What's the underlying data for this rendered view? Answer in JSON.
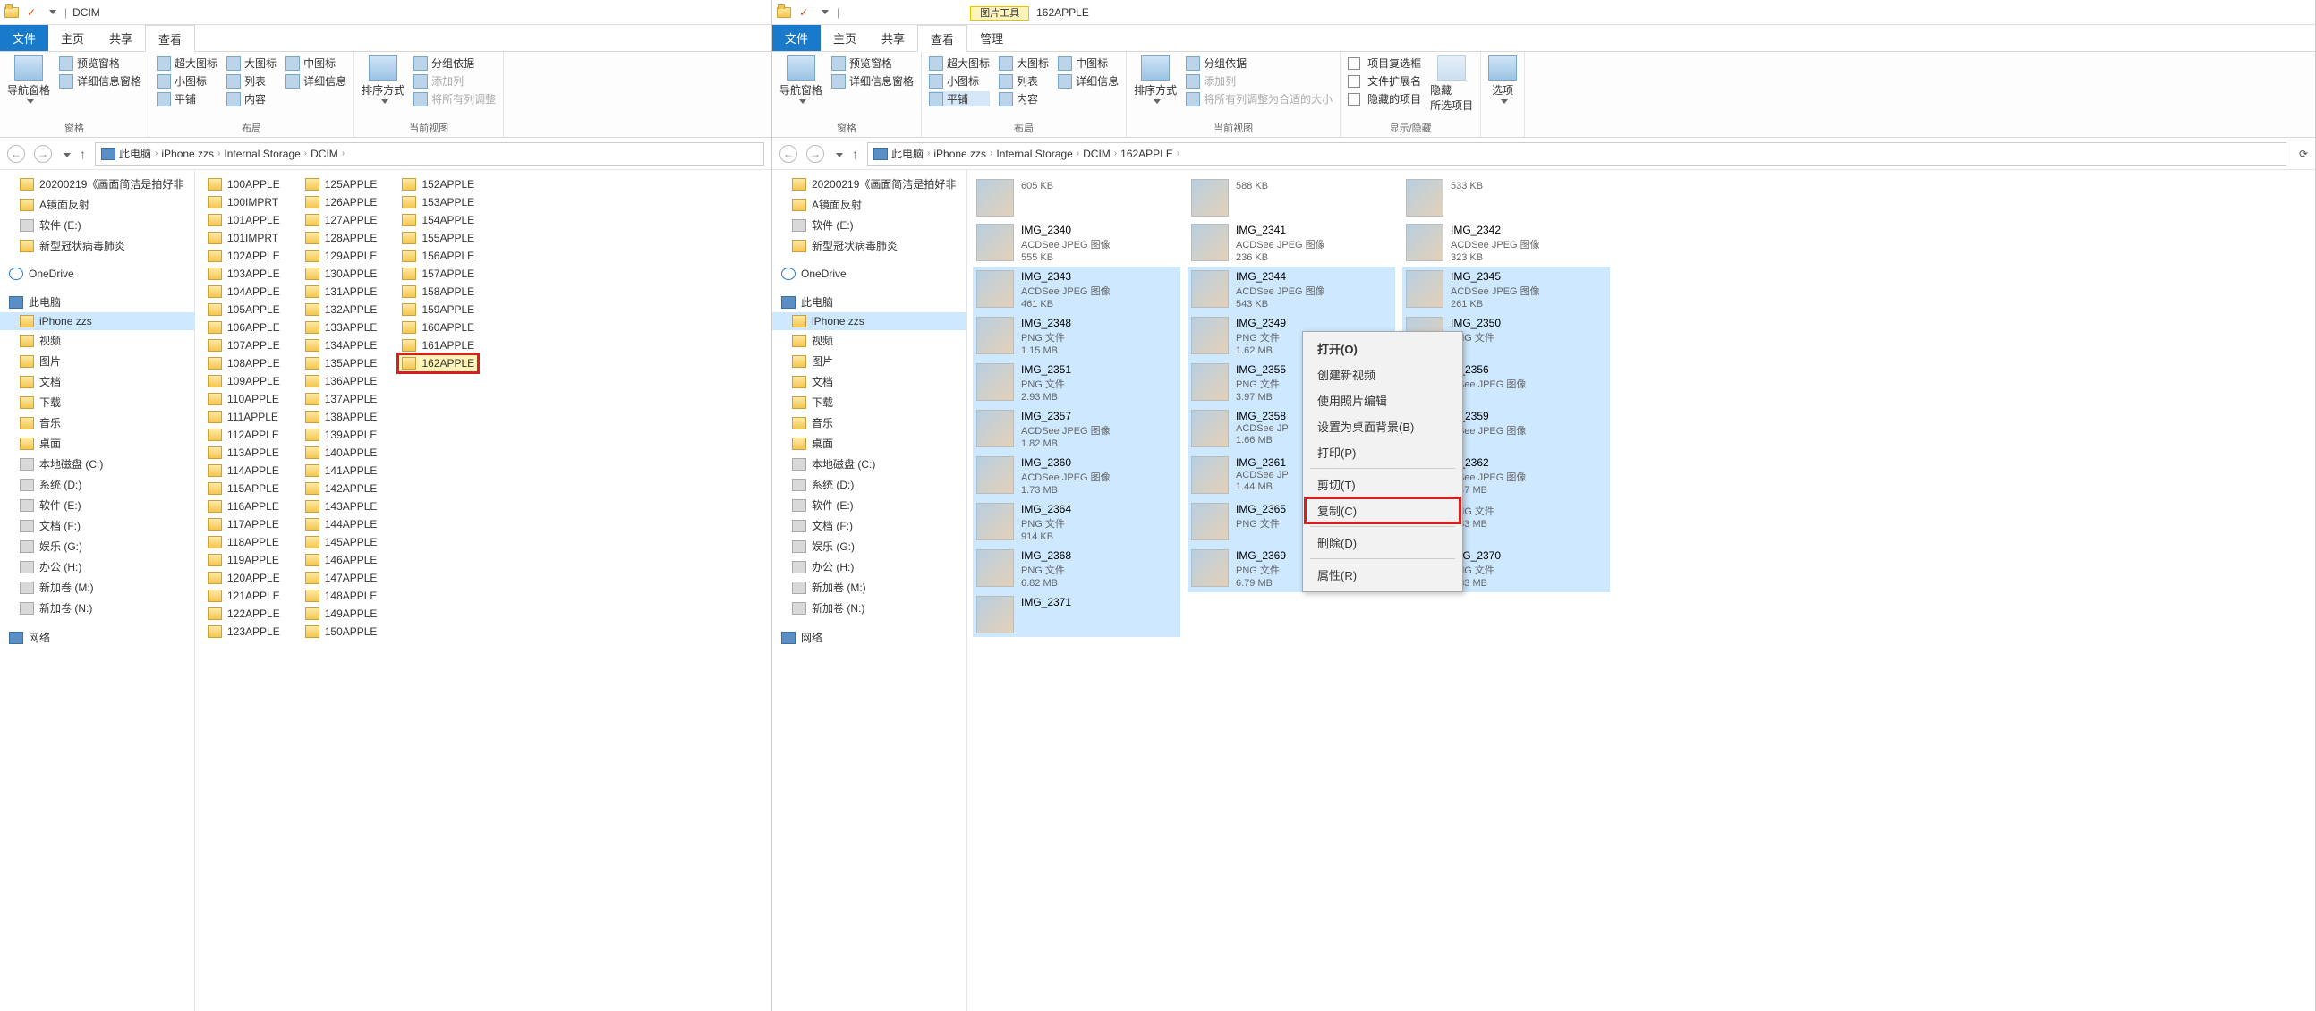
{
  "left": {
    "title": "DCIM",
    "tabs": {
      "file": "文件",
      "home": "主页",
      "share": "共享",
      "view": "查看"
    },
    "ribbon": {
      "nav_pane": "导航窗格",
      "preview": "预览窗格",
      "details_pane": "详细信息窗格",
      "panes_label": "窗格",
      "xl": "超大图标",
      "lg": "大图标",
      "md": "中图标",
      "sm": "小图标",
      "list": "列表",
      "details": "详细信息",
      "tiles": "平铺",
      "content": "内容",
      "layout_label": "布局",
      "sort": "排序方式",
      "group": "分组依据",
      "addcol": "添加列",
      "fitcols": "将所有列调整",
      "curview_label": "当前视图"
    },
    "breadcrumb": [
      "此电脑",
      "iPhone zzs",
      "Internal Storage",
      "DCIM"
    ],
    "tree": [
      {
        "l": "20200219《画面简洁是拍好非",
        "i": "folder"
      },
      {
        "l": "A镜面反射",
        "i": "folder"
      },
      {
        "l": "软件 (E:)",
        "i": "drive"
      },
      {
        "l": "新型冠状病毒肺炎",
        "i": "folder"
      },
      {
        "sep": true
      },
      {
        "l": "OneDrive",
        "i": "cloud",
        "top": true
      },
      {
        "sep": true
      },
      {
        "l": "此电脑",
        "i": "pc",
        "top": true
      },
      {
        "l": "iPhone zzs",
        "i": "folder",
        "sel": true
      },
      {
        "l": "视频",
        "i": "folder"
      },
      {
        "l": "图片",
        "i": "folder"
      },
      {
        "l": "文档",
        "i": "folder"
      },
      {
        "l": "下载",
        "i": "folder"
      },
      {
        "l": "音乐",
        "i": "folder"
      },
      {
        "l": "桌面",
        "i": "folder"
      },
      {
        "l": "本地磁盘 (C:)",
        "i": "drive"
      },
      {
        "l": "系统 (D:)",
        "i": "drive"
      },
      {
        "l": "软件 (E:)",
        "i": "drive"
      },
      {
        "l": "文档 (F:)",
        "i": "drive"
      },
      {
        "l": "娱乐 (G:)",
        "i": "drive"
      },
      {
        "l": "办公 (H:)",
        "i": "drive"
      },
      {
        "l": "新加卷 (M:)",
        "i": "drive"
      },
      {
        "l": "新加卷 (N:)",
        "i": "drive"
      },
      {
        "sep": true
      },
      {
        "l": "网络",
        "i": "pc",
        "top": true
      }
    ],
    "folders_col1": [
      "100APPLE",
      "100IMPRT",
      "101APPLE",
      "101IMPRT",
      "102APPLE",
      "103APPLE",
      "104APPLE",
      "105APPLE",
      "106APPLE",
      "107APPLE",
      "108APPLE",
      "109APPLE",
      "110APPLE",
      "111APPLE",
      "112APPLE",
      "113APPLE",
      "114APPLE",
      "115APPLE",
      "116APPLE",
      "117APPLE",
      "118APPLE",
      "119APPLE",
      "120APPLE",
      "121APPLE",
      "122APPLE",
      "123APPLE"
    ],
    "folders_col2": [
      "125APPLE",
      "126APPLE",
      "127APPLE",
      "128APPLE",
      "129APPLE",
      "130APPLE",
      "131APPLE",
      "132APPLE",
      "133APPLE",
      "134APPLE",
      "135APPLE",
      "136APPLE",
      "137APPLE",
      "138APPLE",
      "139APPLE",
      "140APPLE",
      "141APPLE",
      "142APPLE",
      "143APPLE",
      "144APPLE",
      "145APPLE",
      "146APPLE",
      "147APPLE",
      "148APPLE",
      "149APPLE",
      "150APPLE"
    ],
    "folders_col3": [
      "152APPLE",
      "153APPLE",
      "154APPLE",
      "155APPLE",
      "156APPLE",
      "157APPLE",
      "158APPLE",
      "159APPLE",
      "160APPLE",
      "161APPLE",
      "162APPLE"
    ],
    "hl_folder": "162APPLE"
  },
  "right": {
    "title": "162APPLE",
    "tool_tab": "图片工具",
    "tool_sub": "管理",
    "tabs": {
      "file": "文件",
      "home": "主页",
      "share": "共享",
      "view": "查看"
    },
    "ribbon": {
      "nav_pane": "导航窗格",
      "preview": "预览窗格",
      "details_pane": "详细信息窗格",
      "panes_label": "窗格",
      "xl": "超大图标",
      "lg": "大图标",
      "md": "中图标",
      "sm": "小图标",
      "list": "列表",
      "details": "详细信息",
      "tiles": "平铺",
      "content": "内容",
      "layout_label": "布局",
      "sort": "排序方式",
      "group": "分组依据",
      "addcol": "添加列",
      "fitcols": "将所有列调整为合适的大小",
      "curview_label": "当前视图",
      "item_chk": "项目复选框",
      "ext": "文件扩展名",
      "hidden": "隐藏的项目",
      "hide_sel": "隐藏\n所选项目",
      "showhide_label": "显示/隐藏",
      "options": "选项"
    },
    "breadcrumb": [
      "此电脑",
      "iPhone zzs",
      "Internal Storage",
      "DCIM",
      "162APPLE"
    ],
    "tree": [
      {
        "l": "20200219《画面简洁是拍好非",
        "i": "folder"
      },
      {
        "l": "A镜面反射",
        "i": "folder"
      },
      {
        "l": "软件 (E:)",
        "i": "drive"
      },
      {
        "l": "新型冠状病毒肺炎",
        "i": "folder"
      },
      {
        "sep": true
      },
      {
        "l": "OneDrive",
        "i": "cloud",
        "top": true
      },
      {
        "sep": true
      },
      {
        "l": "此电脑",
        "i": "pc",
        "top": true
      },
      {
        "l": "iPhone zzs",
        "i": "folder",
        "sel": true
      },
      {
        "l": "视频",
        "i": "folder"
      },
      {
        "l": "图片",
        "i": "folder"
      },
      {
        "l": "文档",
        "i": "folder"
      },
      {
        "l": "下载",
        "i": "folder"
      },
      {
        "l": "音乐",
        "i": "folder"
      },
      {
        "l": "桌面",
        "i": "folder"
      },
      {
        "l": "本地磁盘 (C:)",
        "i": "drive"
      },
      {
        "l": "系统 (D:)",
        "i": "drive"
      },
      {
        "l": "软件 (E:)",
        "i": "drive"
      },
      {
        "l": "文档 (F:)",
        "i": "drive"
      },
      {
        "l": "娱乐 (G:)",
        "i": "drive"
      },
      {
        "l": "办公 (H:)",
        "i": "drive"
      },
      {
        "l": "新加卷 (M:)",
        "i": "drive"
      },
      {
        "l": "新加卷 (N:)",
        "i": "drive"
      },
      {
        "sep": true
      },
      {
        "l": "网络",
        "i": "pc",
        "top": true
      }
    ],
    "thumbs": [
      [
        {
          "n": "",
          "t": "",
          "s": "605 KB"
        },
        {
          "n": "",
          "t": "",
          "s": "588 KB"
        },
        {
          "n": "",
          "t": "",
          "s": "533 KB"
        }
      ],
      [
        {
          "n": "IMG_2340",
          "t": "ACDSee JPEG 图像",
          "s": "555 KB"
        },
        {
          "n": "IMG_2341",
          "t": "ACDSee JPEG 图像",
          "s": "236 KB"
        },
        {
          "n": "IMG_2342",
          "t": "ACDSee JPEG 图像",
          "s": "323 KB"
        }
      ],
      [
        {
          "n": "IMG_2343",
          "t": "ACDSee JPEG 图像",
          "s": "461 KB",
          "sel": true
        },
        {
          "n": "IMG_2344",
          "t": "ACDSee JPEG 图像",
          "s": "543 KB",
          "sel": true
        },
        {
          "n": "IMG_2345",
          "t": "ACDSee JPEG 图像",
          "s": "261 KB",
          "sel": true
        }
      ],
      [
        {
          "n": "IMG_2348",
          "t": "PNG 文件",
          "s": "1.15 MB",
          "sel": true
        },
        {
          "n": "IMG_2349",
          "t": "PNG 文件",
          "s": "1.62 MB",
          "sel": true
        },
        {
          "n": "IMG_2350",
          "t": "PNG 文件",
          "s": "",
          "sel": true
        }
      ],
      [
        {
          "n": "IMG_2351",
          "t": "PNG 文件",
          "s": "2.93 MB",
          "sel": true
        },
        {
          "n": "IMG_2355",
          "t": "PNG 文件",
          "s": "3.97 MB",
          "sel": true
        },
        {
          "n": "G_2356",
          "t": "DSee JPEG 图像",
          "s": "",
          "sel": true
        }
      ],
      [
        {
          "n": "IMG_2357",
          "t": "ACDSee JPEG 图像",
          "s": "1.82 MB",
          "sel": true
        },
        {
          "n": "IMG_2358",
          "t": "ACDSee JP",
          "s": "1.66 MB",
          "sel": true
        },
        {
          "n": "G_2359",
          "t": "DSee JPEG 图像",
          "s": "",
          "sel": true
        }
      ],
      [
        {
          "n": "IMG_2360",
          "t": "ACDSee JPEG 图像",
          "s": "1.73 MB",
          "sel": true
        },
        {
          "n": "IMG_2361",
          "t": "ACDSee JP",
          "s": "1.44 MB",
          "sel": true
        },
        {
          "n": "G_2362",
          "t": "DSee JPEG 图像",
          "s": "1.47 MB",
          "sel": true
        }
      ],
      [
        {
          "n": "IMG_2364",
          "t": "PNG 文件",
          "s": "914 KB",
          "sel": true
        },
        {
          "n": "IMG_2365",
          "t": "PNG 文件",
          "s": "",
          "sel": true
        },
        {
          "n": "",
          "t": "PNG 文件",
          "s": "1.83 MB",
          "sel": true
        }
      ],
      [
        {
          "n": "IMG_2368",
          "t": "PNG 文件",
          "s": "6.82 MB",
          "sel": true
        },
        {
          "n": "IMG_2369",
          "t": "PNG 文件",
          "s": "6.79 MB",
          "sel": true
        },
        {
          "n": "IMG_2370",
          "t": "PNG 文件",
          "s": "1.83 MB",
          "sel": true
        }
      ],
      [
        {
          "n": "IMG_2371",
          "t": "",
          "s": "",
          "sel": true
        }
      ]
    ],
    "ctx": {
      "open": "打开(O)",
      "newvid": "创建新视频",
      "editphoto": "使用照片编辑",
      "wallpaper": "设置为桌面背景(B)",
      "print": "打印(P)",
      "cut": "剪切(T)",
      "copy": "复制(C)",
      "delete": "删除(D)",
      "props": "属性(R)"
    }
  }
}
